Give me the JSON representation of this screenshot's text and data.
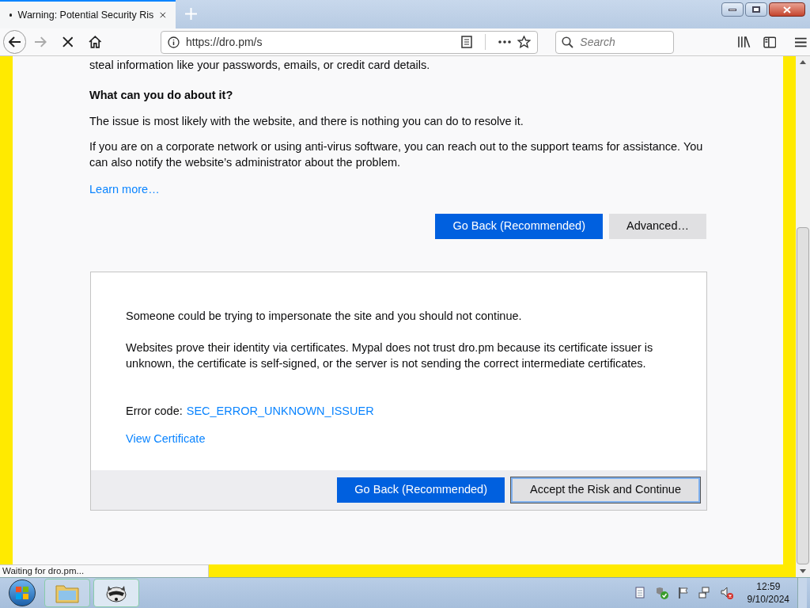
{
  "tab": {
    "title": "Warning: Potential Security Ris",
    "selected": true
  },
  "toolbar": {
    "url": "https://dro.pm/s",
    "search_placeholder": "Search"
  },
  "page": {
    "cut_line": "steal information like your passwords, emails, or credit card details.",
    "heading": "What can you do about it?",
    "paragraphs": [
      "The issue is most likely with the website, and there is nothing you can do to resolve it.",
      "If you are on a corporate network or using anti-virus software, you can reach out to the support teams for assistance. You can also notify the website’s administrator about the problem."
    ],
    "learn_more": "Learn more…",
    "buttons": [
      {
        "label": "Go Back (Recommended)",
        "kind": "primary"
      },
      {
        "label": "Advanced…",
        "kind": "secondary"
      }
    ]
  },
  "advanced": {
    "paragraphs": [
      "Someone could be trying to impersonate the site and you should not continue.",
      "Websites prove their identity via certificates. Mypal does not trust dro.pm because its certificate issuer is unknown, the certificate is self-signed, or the server is not sending the correct intermediate certificates."
    ],
    "error_label": "Error code:",
    "error_code": "SEC_ERROR_UNKNOWN_ISSUER",
    "view_certificate": "View Certificate",
    "buttons": [
      {
        "label": "Go Back (Recommended)",
        "kind": "primary"
      },
      {
        "label": "Accept the Risk and Continue",
        "kind": "secondary"
      }
    ]
  },
  "status_bar": "Waiting for dro.pm...",
  "taskbar": {
    "time": "12:59",
    "date": "9/10/2024"
  }
}
